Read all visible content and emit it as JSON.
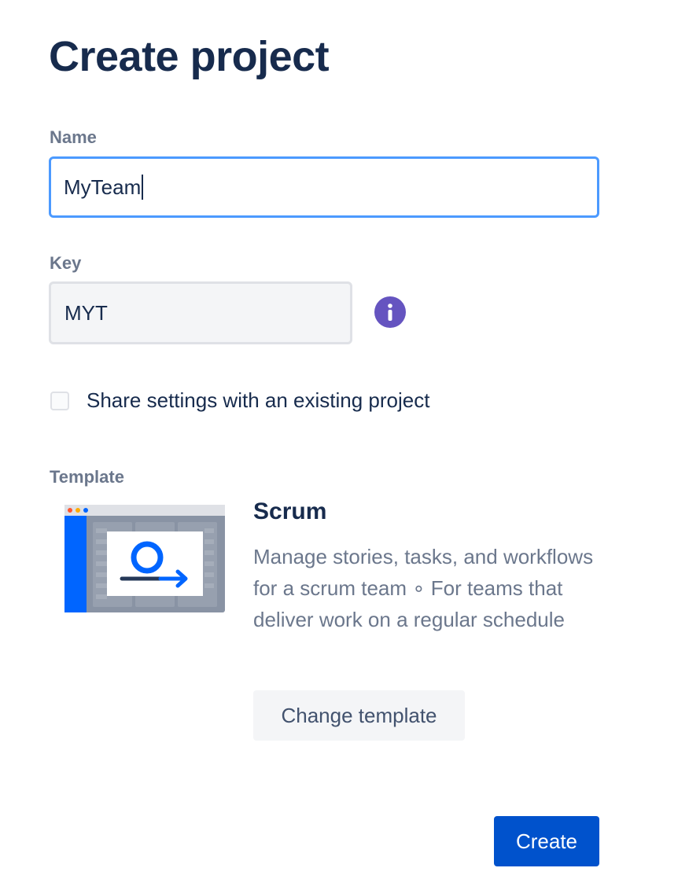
{
  "page": {
    "title": "Create project"
  },
  "form": {
    "name": {
      "label": "Name",
      "value": "MyTeam"
    },
    "key": {
      "label": "Key",
      "value": "MYT",
      "info_icon": "info-icon"
    },
    "share_settings": {
      "label": "Share settings with an existing project",
      "checked": false
    }
  },
  "template": {
    "label": "Template",
    "name": "Scrum",
    "description": "Manage stories, tasks, and workflows for a scrum team ∘ For teams that deliver work on a regular schedule",
    "change_button": "Change template",
    "illustration": "scrum-template-illustration"
  },
  "actions": {
    "create": "Create"
  },
  "colors": {
    "heading": "#172b4d",
    "label": "#6b778c",
    "focus_border": "#4c9aff",
    "info_icon": "#6554c0",
    "primary_button": "#0052cc",
    "secondary_button": "#f4f5f7"
  }
}
